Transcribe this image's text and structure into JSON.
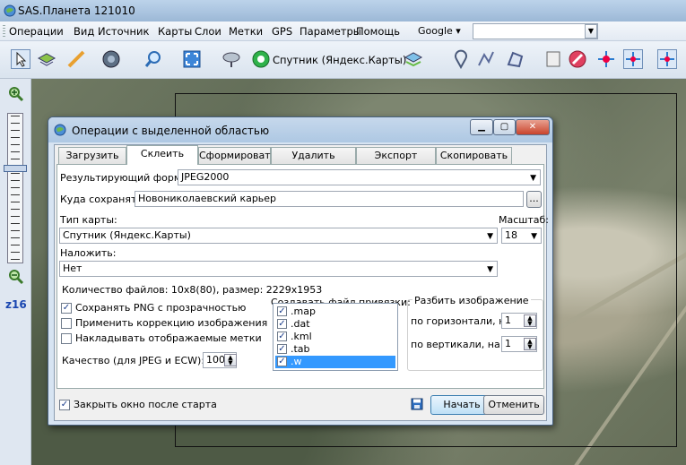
{
  "window": {
    "title": "SAS.Планета 121010"
  },
  "menu": {
    "items": [
      "Операции",
      "Вид",
      "Источник",
      "Карты",
      "Слои",
      "Метки",
      "GPS",
      "Параметры",
      "Помощь"
    ],
    "geocoder": "Google",
    "search_value": ""
  },
  "toolbar": {
    "map_source": "Спутник (Яндекс.Карты)"
  },
  "zoom": {
    "level_label": "z16"
  },
  "dialog": {
    "title": "Операции с выделенной областью",
    "tabs": [
      "Загрузить",
      "Склеить",
      "Сформировать",
      "Удалить",
      "Экспорт",
      "Скопировать"
    ],
    "active_tab": 1,
    "format_label": "Результирующий формат:",
    "format_value": "JPEG2000",
    "save_to_label": "Куда сохранять:",
    "save_to_value": "Новониколаевский карьер",
    "browse_label": "...",
    "map_type_label": "Тип карты:",
    "map_type_value": "Спутник (Яндекс.Карты)",
    "scale_label": "Масштаб:",
    "scale_value": "18",
    "overlay_label": "Наложить:",
    "overlay_value": "Нет",
    "file_count": "Количество файлов: 10x8(80), размер: 2229x1953",
    "options": [
      {
        "label": "Сохранять  PNG с прозрачностью",
        "checked": true
      },
      {
        "label": "Применить коррекцию изображения",
        "checked": false
      },
      {
        "label": "Накладывать отображаемые метки",
        "checked": false
      }
    ],
    "quality_label": "Качество (для JPEG и ECW):",
    "quality_value": "100",
    "georef_label": "Создавать файл привязки:",
    "georef_formats": [
      {
        "label": ".map",
        "checked": true
      },
      {
        "label": ".dat",
        "checked": true
      },
      {
        "label": ".kml",
        "checked": true
      },
      {
        "label": ".tab",
        "checked": true
      },
      {
        "label": ".w",
        "checked": true,
        "selected": true
      }
    ],
    "split_label": "Разбить изображение",
    "split_h_label": "по горизонтали, на",
    "split_h_value": "1",
    "split_v_label": "по вертикали, на",
    "split_v_value": "1",
    "close_after_label": "Закрыть окно после старта",
    "close_after_checked": true,
    "start_button": "Начать",
    "cancel_button": "Отменить"
  }
}
